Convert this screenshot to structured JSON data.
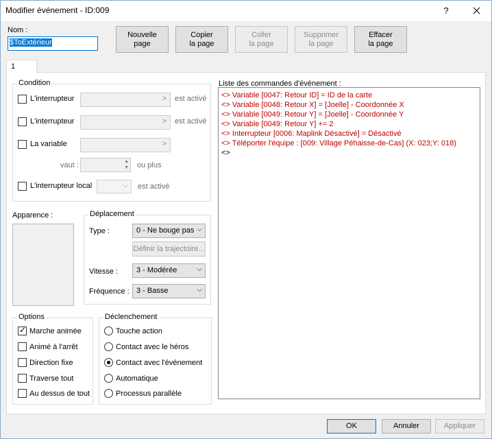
{
  "window": {
    "title": "Modifier événement - ID:009",
    "help_label": "?"
  },
  "name": {
    "label": "Nom :",
    "value": "$ToExtérieur"
  },
  "toolbar": {
    "new_page": "Nouvelle\npage",
    "copy_page": "Copier\nla page",
    "paste_page": "Coller\nla page",
    "delete_page": "Supprimer\nla page",
    "clear_page": "Effacer\nla page"
  },
  "tabs": [
    {
      "label": "1"
    }
  ],
  "condition": {
    "title": "Condition",
    "switch1_label": "L'interrupteur",
    "switch1_suffix": "est activé",
    "switch2_label": "L'interrupteur",
    "switch2_suffix": "est activé",
    "variable_label": "La variable",
    "vaut_label": "vaut :",
    "ou_plus": "ou plus",
    "local_switch_label": "L'interrupteur local",
    "local_suffix": "est activé"
  },
  "appearance": {
    "label": "Apparence :"
  },
  "movement": {
    "title": "Déplacement",
    "type_label": "Type :",
    "type_value": "0 - Ne bouge pas",
    "route_button": "Définir la trajectoire...",
    "speed_label": "Vitesse :",
    "speed_value": "3 - Modérée",
    "freq_label": "Fréquence :",
    "freq_value": "3 - Basse"
  },
  "options": {
    "title": "Options",
    "items": [
      {
        "label": "Marche animée",
        "checked": true
      },
      {
        "label": "Animé à l'arrêt",
        "checked": false
      },
      {
        "label": "Direction fixe",
        "checked": false
      },
      {
        "label": "Traverse tout",
        "checked": false
      },
      {
        "label": "Au dessus de tout",
        "checked": false
      }
    ]
  },
  "trigger": {
    "title": "Déclenchement",
    "items": [
      {
        "label": "Touche action",
        "checked": false
      },
      {
        "label": "Contact avec le héros",
        "checked": false
      },
      {
        "label": "Contact avec l'événement",
        "checked": true
      },
      {
        "label": "Automatique",
        "checked": false
      },
      {
        "label": "Processus parallèle",
        "checked": false
      }
    ]
  },
  "commands": {
    "label": "Liste des commandes d'événement :",
    "items": [
      "<> Variable [0047: Retour ID] = ID de la carte",
      "<> Variable [0048: Retour X] = [Joelle] - Coordonnée X",
      "<> Variable [0049: Retour Y] = [Joelle] - Coordonnée Y",
      "<> Variable [0049: Retour Y] += 2",
      "<> Interrupteur [0006: Maplink Désactivé] = Désactivé",
      "<> Téléporter l'équipe : [009: Village Péhaisse-de-Cas] (X: 023;Y: 018)",
      "<>"
    ]
  },
  "footer": {
    "ok": "OK",
    "cancel": "Annuler",
    "apply": "Appliquer"
  }
}
